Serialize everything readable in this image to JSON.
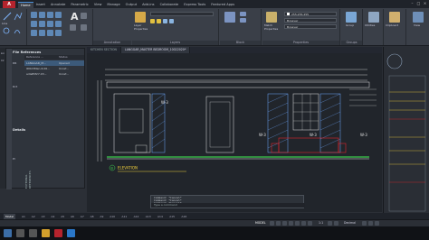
{
  "app": {
    "logo": "A",
    "ribbon_tabs": [
      "Home",
      "Insert",
      "Annotate",
      "Parametric",
      "View",
      "Manage",
      "Output",
      "Add-ins",
      "Collaborate",
      "Express Tools",
      "Featured Apps"
    ],
    "active_tab": "Home"
  },
  "ribbon": {
    "draw_tools": [
      "Line"
    ],
    "panels": {
      "annotation": "Annotation",
      "layers": "Layers",
      "block": "Block",
      "properties": "Properties",
      "groups": "Groups",
      "layer_properties": "Layer\nProperties",
      "match_properties": "Match\nProperties",
      "group": "Group",
      "utilities": "Utilities",
      "clipboard": "Clipboard",
      "view": "View"
    },
    "color_value": "255,255,255",
    "linetype_value": "ByLayer",
    "lineweight_value": "ByLayer"
  },
  "doc_tabs": [
    "KITCHEN SECTION",
    "LANGGAR_MASTER BEDROOM_10022020*"
  ],
  "active_doc_tab": 1,
  "palette": {
    "title": "File References",
    "columns": [
      "Reference ...",
      "Status"
    ],
    "rows": [
      {
        "name": "LANGGAR_M...",
        "status": "Opened"
      },
      {
        "name": "IDR23Men-6.06...",
        "status": "Unref..."
      },
      {
        "name": "adleEM27-03...",
        "status": "Unref..."
      }
    ],
    "details": "Details",
    "vertical_label": "EXTERNAL REFERENCES",
    "side_labels": [
      "DR",
      "Dct",
      "Pr"
    ]
  },
  "left_tools": [
    "Lin",
    "Dr"
  ],
  "drawing": {
    "elevation_label": "ELEVATION",
    "marker_letter": "B",
    "wall_tags": [
      "W-3",
      "W-3",
      "W-3",
      "W-3"
    ],
    "bg_color": "#21252b",
    "line_color": "#e6e6e6",
    "accent_red": "#e0262c",
    "accent_yellow": "#f0d03c",
    "accent_green": "#3ccf4e"
  },
  "command_line": {
    "rows": [
      "Command: *Cancel*",
      "Command: *Cancel*",
      "Command: *Cancel*",
      "Command: *Cancel*"
    ],
    "placeholder": "Type a command"
  },
  "layout_tabs": [
    "Model",
    "A1",
    "A2",
    "A3",
    "A4",
    "A5",
    "A6",
    "A7",
    "A8",
    "A9",
    "A10",
    "A11",
    "A12",
    "A13",
    "A14",
    "A15",
    "A16"
  ],
  "active_layout_tab": "Model",
  "status_bar": {
    "model": "MODEL",
    "scale": "1:1",
    "decimal": "Decimal"
  }
}
